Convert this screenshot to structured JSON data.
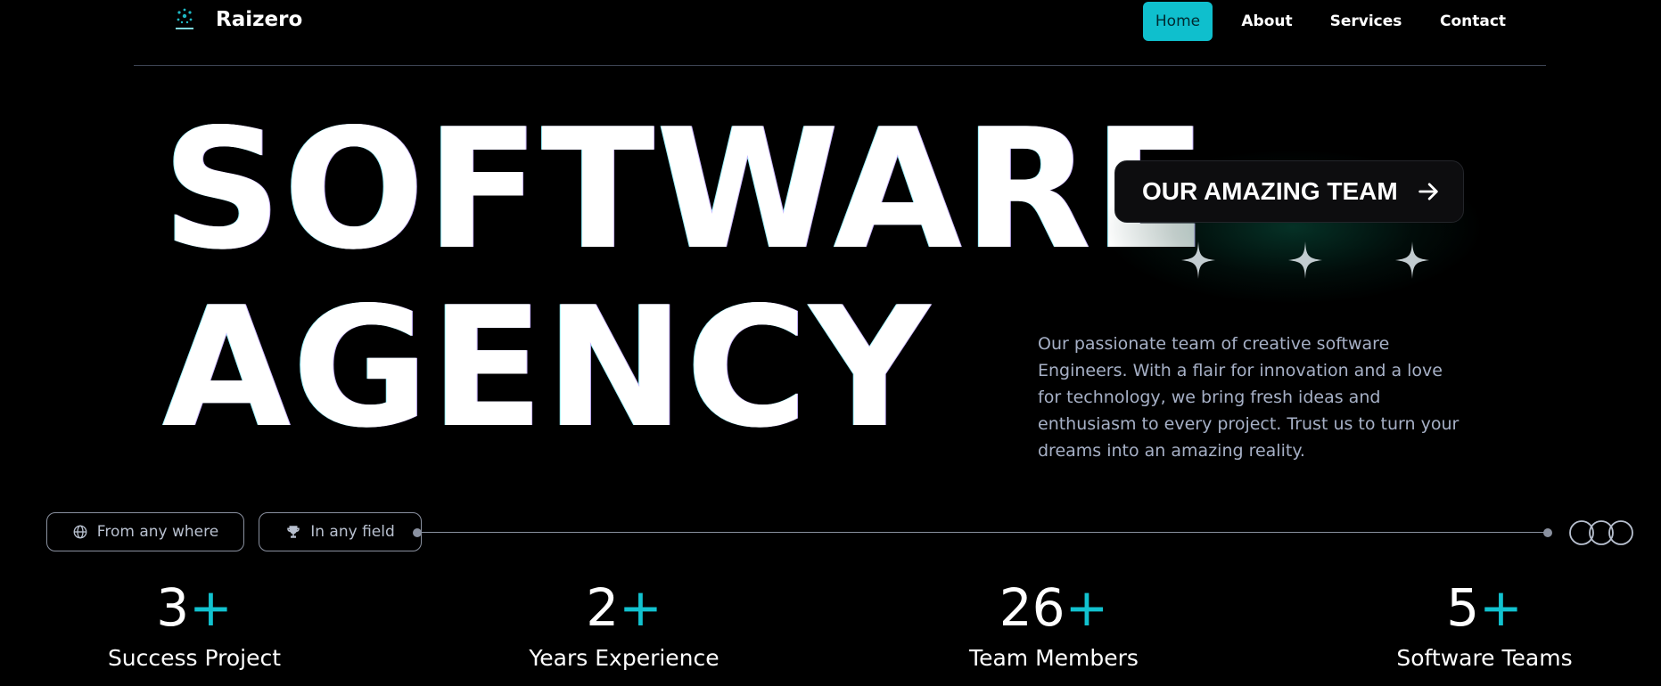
{
  "brand": {
    "name": "Raizero"
  },
  "nav": {
    "items": [
      {
        "label": "Home",
        "active": true
      },
      {
        "label": "About",
        "active": false
      },
      {
        "label": "Services",
        "active": false
      },
      {
        "label": "Contact",
        "active": false
      }
    ]
  },
  "hero": {
    "line1": "SOFTWARE",
    "line2": "AGENCY",
    "team_button": "OUR AMAZING TEAM",
    "description": "Our passionate team of creative software Engineers. With a flair for innovation and a love for technology, we bring fresh ideas and enthusiasm to every project. Trust us to turn your dreams into an amazing reality."
  },
  "pills": [
    {
      "label": "From any where",
      "icon": "globe-icon"
    },
    {
      "label": "In any field",
      "icon": "trophy-icon"
    }
  ],
  "stats": [
    {
      "number": "3",
      "suffix": "+",
      "label": "Success Project"
    },
    {
      "number": "2",
      "suffix": "+",
      "label": "Years Experience"
    },
    {
      "number": "26",
      "suffix": "+",
      "label": "Team Members"
    },
    {
      "number": "5",
      "suffix": "+",
      "label": "Software Teams"
    }
  ],
  "colors": {
    "accent": "#0fbfcd",
    "background": "#000000",
    "muted_text": "#a6b0c6"
  }
}
